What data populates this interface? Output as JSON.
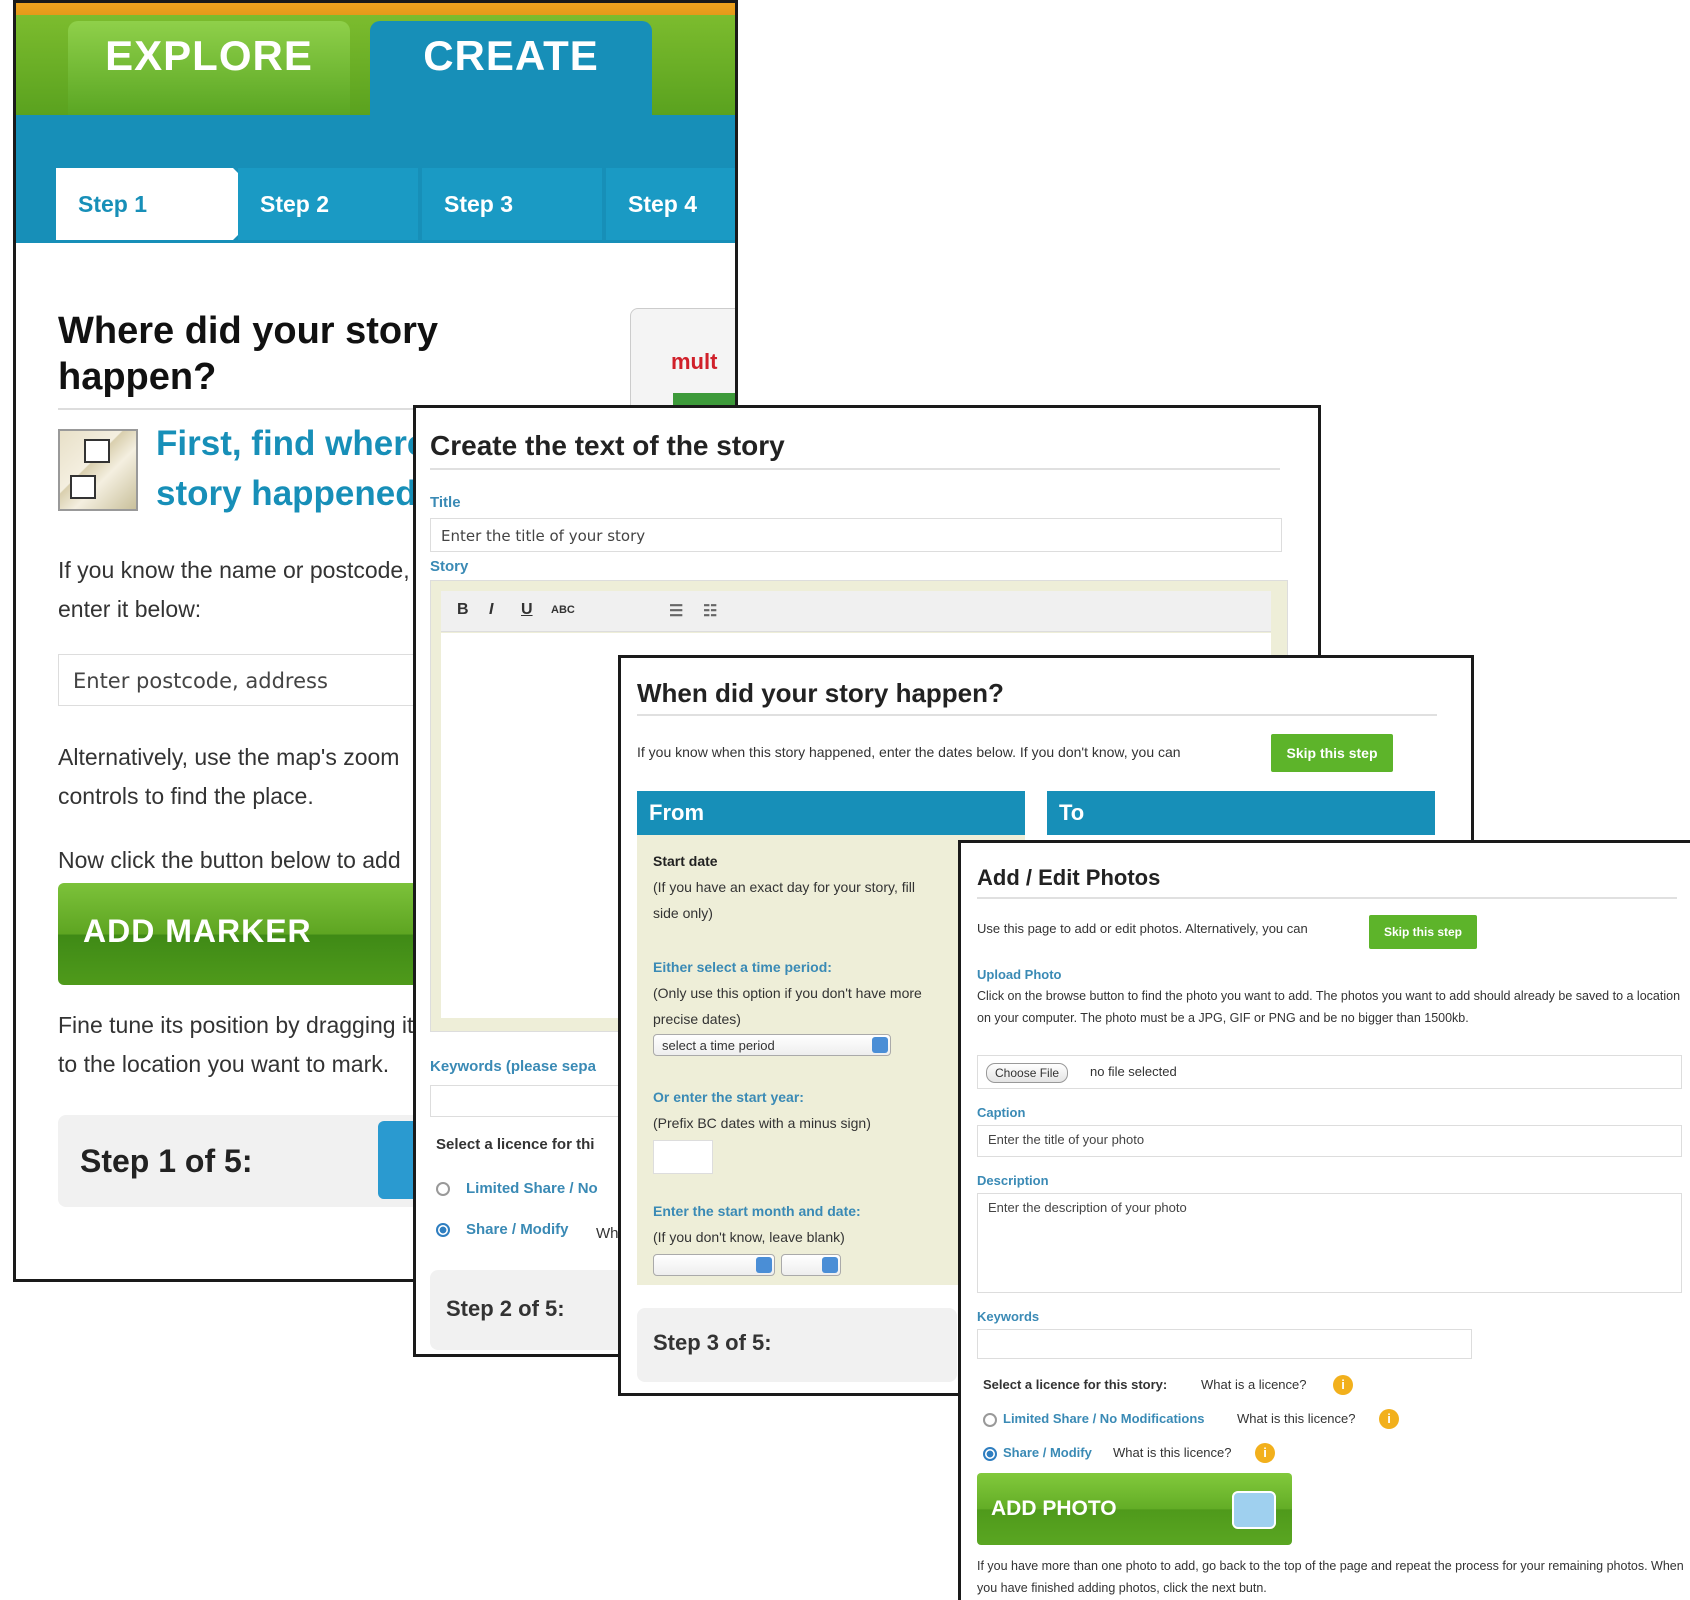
{
  "panel1": {
    "tabs": {
      "explore": "EXPLORE",
      "create": "CREATE"
    },
    "steps": [
      "Step 1",
      "Step 2",
      "Step 3",
      "Step 4"
    ],
    "heading": "Where did your story happen?",
    "subheading": "First, find where your story happened",
    "para1": "If you know the name or postcode, enter it below:",
    "postcode_placeholder": "Enter postcode, address",
    "para2": "Alternatively, use the map's zoom controls to find the place.",
    "para3": "Now click the button below to add",
    "add_marker": "ADD MARKER",
    "para4": "Fine tune its position by dragging it to the location you want to mark.",
    "step_indicator": "Step 1 of 5:",
    "map_logo_text": "mult"
  },
  "panel2": {
    "title": "Create the text of the story",
    "title_label": "Title",
    "title_placeholder": "Enter the title of your story",
    "story_label": "Story",
    "toolbar": {
      "bold": "B",
      "italic": "I",
      "underline": "U",
      "strike": "ABC"
    },
    "keywords_label": "Keywords (please sepa",
    "licence_label": "Select a licence for thi",
    "licence_options": [
      "Limited Share / No",
      "Share / Modify"
    ],
    "licence_what": "Wh",
    "step_indicator": "Step 2 of 5:"
  },
  "panel3": {
    "title": "When did your story happen?",
    "intro": "If you know when this story happened, enter the dates below. If you don't know, you can",
    "skip": "Skip this step",
    "from": "From",
    "to": "To",
    "start_date_label": "Start date",
    "start_date_hint": "(If you have an exact day for your story, fill",
    "start_date_hint2": "side only)",
    "period_label": "Either select a time period:",
    "period_hint": "(Only use this option if you don't have more",
    "period_hint2": "precise dates)",
    "period_select": "select a time period",
    "year_label": "Or enter the start year:",
    "year_hint": "(Prefix BC dates with a minus sign)",
    "month_label": "Enter the start month and date:",
    "month_hint": "(If you don't know, leave blank)",
    "step_indicator": "Step 3 of 5:"
  },
  "panel4": {
    "title": "Add / Edit Photos",
    "intro": "Use this page to add or edit photos. Alternatively, you can",
    "skip": "Skip this step",
    "upload_label": "Upload Photo",
    "upload_text": "Click on the browse button to find the photo you want to add. The photos you want to add should already be saved to a location on your computer. The photo must be a JPG, GIF or PNG and be no bigger than 1500kb.",
    "choose_file": "Choose File",
    "no_file": "no file selected",
    "caption_label": "Caption",
    "caption_placeholder": "Enter the title of your photo",
    "description_label": "Description",
    "description_placeholder": "Enter the description of your photo",
    "keywords_label": "Keywords",
    "licence_label": "Select a licence for this story:",
    "what_licence": "What is a licence?",
    "licence_options": [
      "Limited Share / No Modifications",
      "Share / Modify"
    ],
    "what_this_licence": "What is this licence?",
    "info_icon": "i",
    "add_photo": "ADD PHOTO",
    "footer": "If you have more than one photo to add, go back to the top of the page and repeat the process for your remaining photos. When you have finished adding photos, click the next butn."
  }
}
